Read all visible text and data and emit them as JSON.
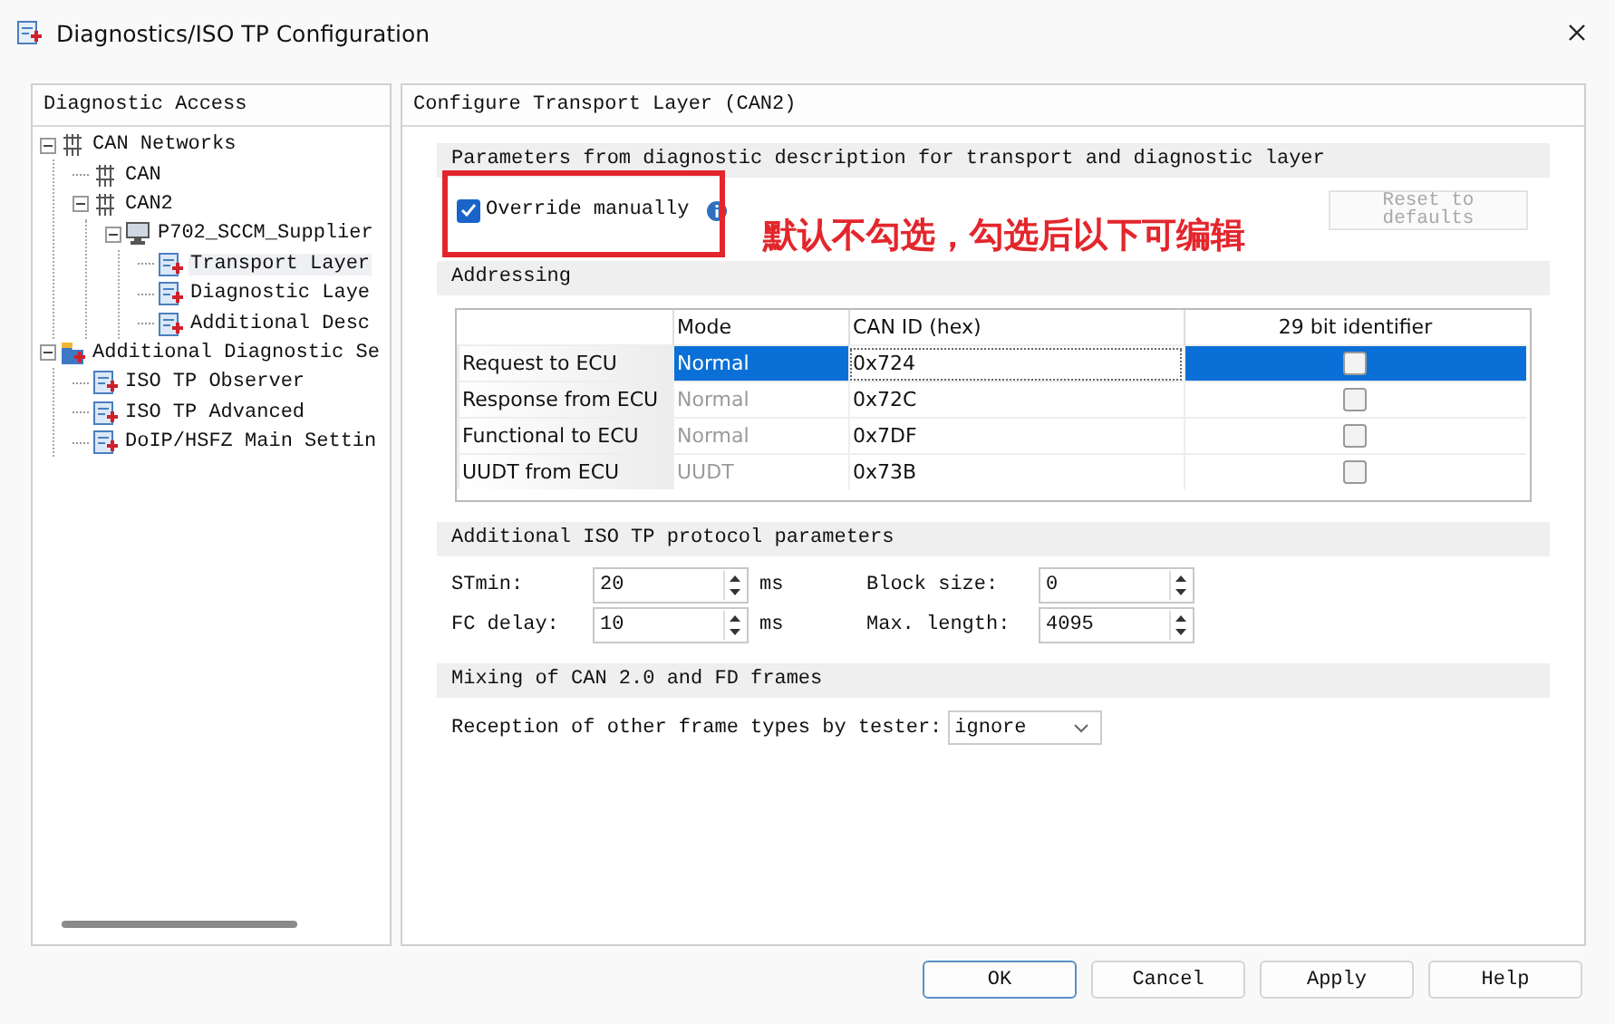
{
  "window": {
    "title": "Diagnostics/ISO TP Configuration"
  },
  "sidebar": {
    "title": "Diagnostic Access",
    "tree": [
      {
        "label": "CAN Networks",
        "kind": "network",
        "expanded": true,
        "selected": false,
        "children": [
          {
            "label": "CAN",
            "kind": "network",
            "selected": false
          },
          {
            "label": "CAN2",
            "kind": "network",
            "expanded": true,
            "selected": false,
            "children": [
              {
                "label": "P702_SCCM_Supplier",
                "kind": "computer",
                "expanded": true,
                "selected": false,
                "children": [
                  {
                    "label": "Transport Layer",
                    "kind": "doc",
                    "selected": true
                  },
                  {
                    "label": "Diagnostic Laye",
                    "kind": "doc",
                    "selected": false
                  },
                  {
                    "label": "Additional Desc",
                    "kind": "doc",
                    "selected": false
                  }
                ]
              }
            ]
          }
        ]
      },
      {
        "label": "Additional Diagnostic Se",
        "kind": "folder",
        "expanded": true,
        "selected": false,
        "children": [
          {
            "label": "ISO TP Observer",
            "kind": "doc",
            "selected": false
          },
          {
            "label": "ISO TP Advanced",
            "kind": "doc",
            "selected": false
          },
          {
            "label": "DoIP/HSFZ Main Settin",
            "kind": "doc",
            "selected": false
          }
        ]
      }
    ]
  },
  "panel": {
    "title": "Configure Transport Layer (CAN2)",
    "sections": [
      {
        "kind": "override",
        "title": "Parameters from diagnostic description for transport and diagnostic layer",
        "checkbox": {
          "label": "Override manually",
          "checked": true
        },
        "reset": {
          "label": "Reset to defaults",
          "disabled": true
        }
      },
      {
        "kind": "table",
        "title": "Addressing",
        "columns": [
          "Mode",
          "CAN ID (hex)",
          "29 bit identifier"
        ],
        "rows": [
          {
            "label": "Request to ECU",
            "mode": "Normal",
            "can_id": "0x724",
            "bit29": false,
            "selected": true
          },
          {
            "label": "Response from ECU",
            "mode": "Normal",
            "can_id": "0x72C",
            "bit29": false,
            "selected": false
          },
          {
            "label": "Functional to ECU",
            "mode": "Normal",
            "can_id": "0x7DF",
            "bit29": false,
            "selected": false
          },
          {
            "label": "UUDT from ECU",
            "mode": "UUDT",
            "can_id": "0x73B",
            "bit29": false,
            "selected": false
          }
        ]
      },
      {
        "kind": "params",
        "title": "Additional ISO TP protocol parameters",
        "params": [
          {
            "label": "STmin:",
            "value": "20",
            "unit": "ms"
          },
          {
            "label": "Block size:",
            "value": "0"
          },
          {
            "label": "FC delay:",
            "value": "10",
            "unit": "ms"
          },
          {
            "label": "Max. length:",
            "value": "4095"
          }
        ]
      },
      {
        "kind": "select",
        "title": "Mixing of CAN 2.0 and FD frames",
        "label": "Reception of other frame types by tester:",
        "value": "ignore"
      }
    ]
  },
  "annotation": {
    "text": "默认不勾选，勾选后以下可编辑"
  },
  "buttons": [
    {
      "label": "OK",
      "default": true
    },
    {
      "label": "Cancel",
      "default": false
    },
    {
      "label": "Apply",
      "default": false
    },
    {
      "label": "Help",
      "default": false
    }
  ]
}
